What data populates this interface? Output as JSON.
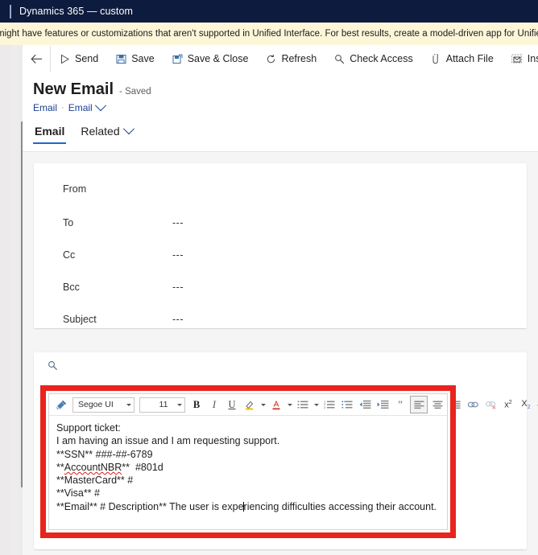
{
  "window": {
    "title": "Dynamics 365 — custom"
  },
  "notification": {
    "text": "might have features or customizations that aren't supported in Unified Interface. For best results, create a model-driven app for Unified Interface."
  },
  "command_bar": {
    "back_label": "Back",
    "items": [
      {
        "label": "Send",
        "icon": "send-icon"
      },
      {
        "label": "Save",
        "icon": "save-icon"
      },
      {
        "label": "Save & Close",
        "icon": "save-close-icon"
      },
      {
        "label": "Refresh",
        "icon": "refresh-icon"
      },
      {
        "label": "Check Access",
        "icon": "check-access-icon"
      },
      {
        "label": "Attach File",
        "icon": "paperclip-icon"
      },
      {
        "label": "Insert Template",
        "icon": "insert-template-icon"
      }
    ]
  },
  "record": {
    "title": "New Email",
    "status": "- Saved",
    "breadcrumb": {
      "entity": "Email",
      "form": "Email"
    },
    "tabs": [
      {
        "label": "Email",
        "active": true
      },
      {
        "label": "Related",
        "active": false
      }
    ]
  },
  "recipients": {
    "fields": [
      {
        "label": "From",
        "value": ""
      },
      {
        "label": "To",
        "value": "---"
      },
      {
        "label": "Cc",
        "value": "---"
      },
      {
        "label": "Bcc",
        "value": "---"
      },
      {
        "label": "Subject",
        "value": "---"
      }
    ]
  },
  "editor": {
    "font_family": "Segoe UI",
    "font_size": "11",
    "toolbar_icons": [
      "format-painter-icon",
      "bold-icon",
      "italic-icon",
      "underline-icon",
      "highlight-color-icon",
      "font-color-icon",
      "bulleted-list-icon",
      "numbered-list-icon",
      "multilevel-list-icon",
      "decrease-indent-icon",
      "increase-indent-icon",
      "blockquote-icon",
      "align-left-icon",
      "align-center-icon",
      "align-right-icon",
      "insert-link-icon",
      "remove-link-icon",
      "superscript-icon",
      "subscript-icon",
      "strikethrough-icon",
      "insert-image-icon",
      "ltr-direction-icon",
      "rtl-direction-icon"
    ],
    "body_lines": [
      {
        "text": "Support ticket:",
        "misspelled": false
      },
      {
        "text": "I am having an issue and I am requesting support.",
        "misspelled": false
      },
      {
        "text": "**SSN** ###-##-6789",
        "misspelled": false
      },
      {
        "text": "**AccountNBR**  #801d",
        "misspelled": true,
        "misspelled_word": "AccountNBR"
      },
      {
        "text": "**MasterCard** #",
        "misspelled": false
      },
      {
        "text": "**Visa** #",
        "misspelled": false
      },
      {
        "text": "**Email** # Description** The user is experiencing difficulties accessing their account.",
        "misspelled": false,
        "caret_after": "**Email** # Description** The user is expe"
      }
    ]
  },
  "colors": {
    "title_bar": "#0d1b3e",
    "notification_bg": "#fdf6d9",
    "accent": "#2266cc",
    "annotation": "#e8241c",
    "link": "#1a3f8f"
  }
}
